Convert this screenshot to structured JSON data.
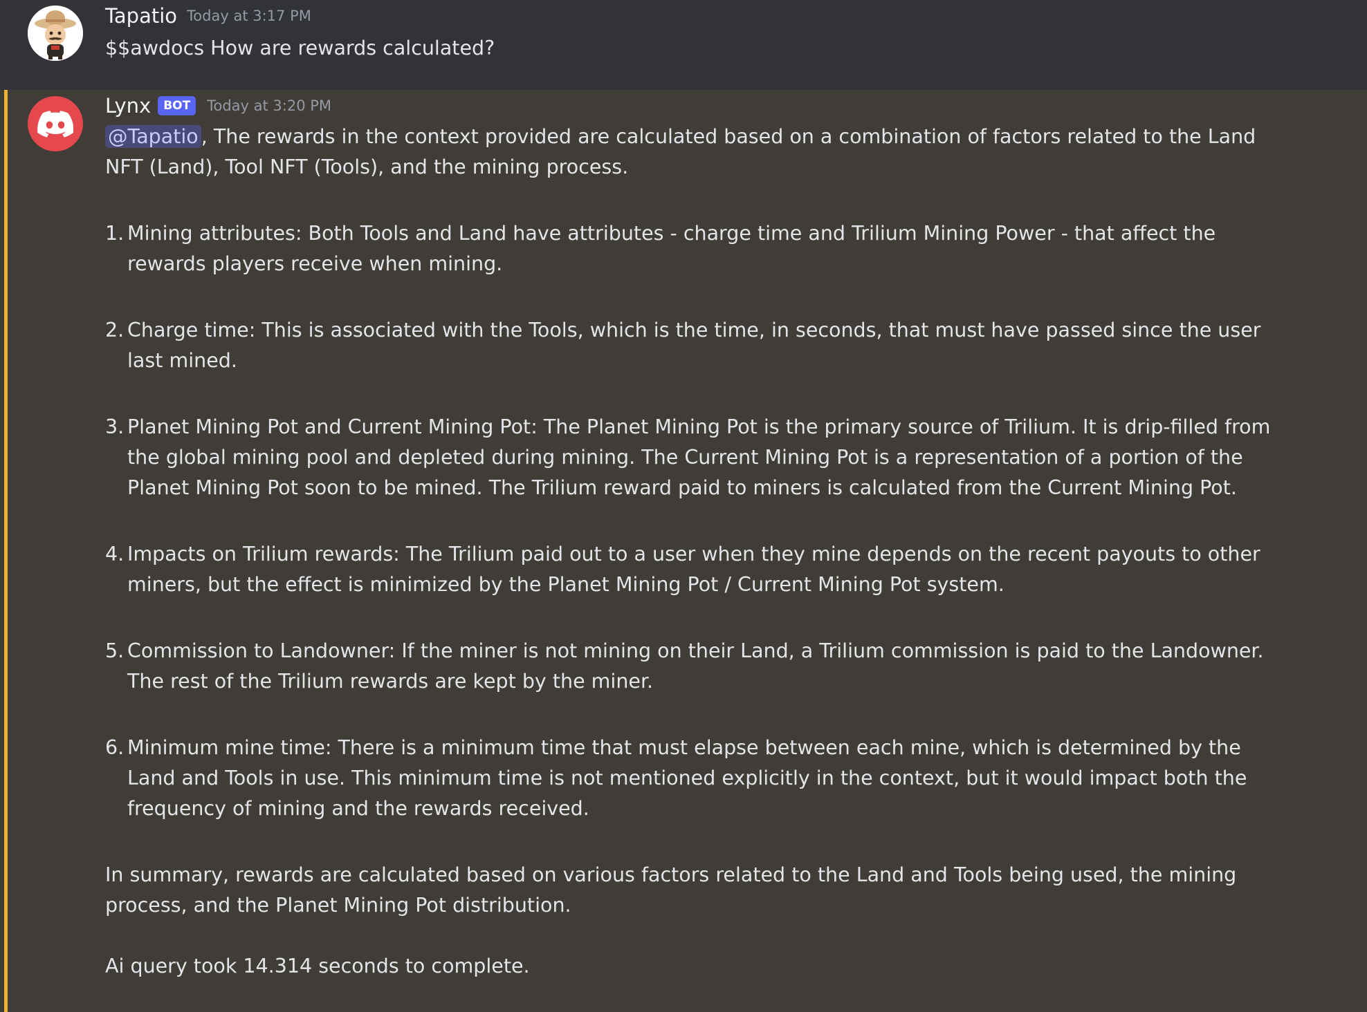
{
  "messages": {
    "user": {
      "username": "Tapatio",
      "timestamp": "Today at 3:17 PM",
      "text": "$$awdocs How are rewards calculated?"
    },
    "bot": {
      "username": "Lynx",
      "badge": "BOT",
      "timestamp": "Today at 3:20 PM",
      "mention": "@Tapatio",
      "intro": ", The rewards in the context provided are calculated based on a combination of factors related to the Land NFT (Land), Tool NFT (Tools), and the mining process.",
      "items": [
        {
          "num": "1.",
          "text": "Mining attributes: Both Tools and Land have attributes - charge time and Trilium Mining Power - that affect the rewards players receive when mining."
        },
        {
          "num": "2.",
          "text": "Charge time: This is associated with the Tools, which is the time, in seconds, that must have passed since the user last mined."
        },
        {
          "num": "3.",
          "text": "Planet Mining Pot and Current Mining Pot: The Planet Mining Pot is the primary source of Trilium. It is drip-filled from the global mining pool and depleted during mining. The Current Mining Pot is a representation of a portion of the Planet Mining Pot soon to be mined. The Trilium reward paid to miners is calculated from the Current Mining Pot."
        },
        {
          "num": "4.",
          "text": "Impacts on Trilium rewards: The Trilium paid out to a user when they mine depends on the recent payouts to other miners, but the effect is minimized by the Planet Mining Pot / Current Mining Pot system."
        },
        {
          "num": "5.",
          "text": "Commission to Landowner: If the miner is not mining on their Land, a Trilium commission is paid to the Landowner. The rest of the Trilium rewards are kept by the miner."
        },
        {
          "num": "6.",
          "text": "Minimum mine time: There is a minimum time that must elapse between each mine, which is determined by the Land and Tools in use. This minimum time is not mentioned explicitly in the context, but it would impact both the frequency of mining and the rewards received."
        }
      ],
      "summary": "In summary, rewards are calculated based on various factors related to the Land and Tools being used, the mining process, and the Planet Mining Pot distribution.",
      "footer": "Ai query took 14.314 seconds to complete."
    }
  },
  "colors": {
    "background": "#313338",
    "mention_highlight_bg": "#403d38",
    "mention_bar": "#f0b232",
    "bot_badge": "#5865f2",
    "bot_avatar": "#e5484d"
  },
  "icons": {
    "user_avatar": "sombrero-character-avatar",
    "bot_avatar": "discord-logo-icon"
  }
}
